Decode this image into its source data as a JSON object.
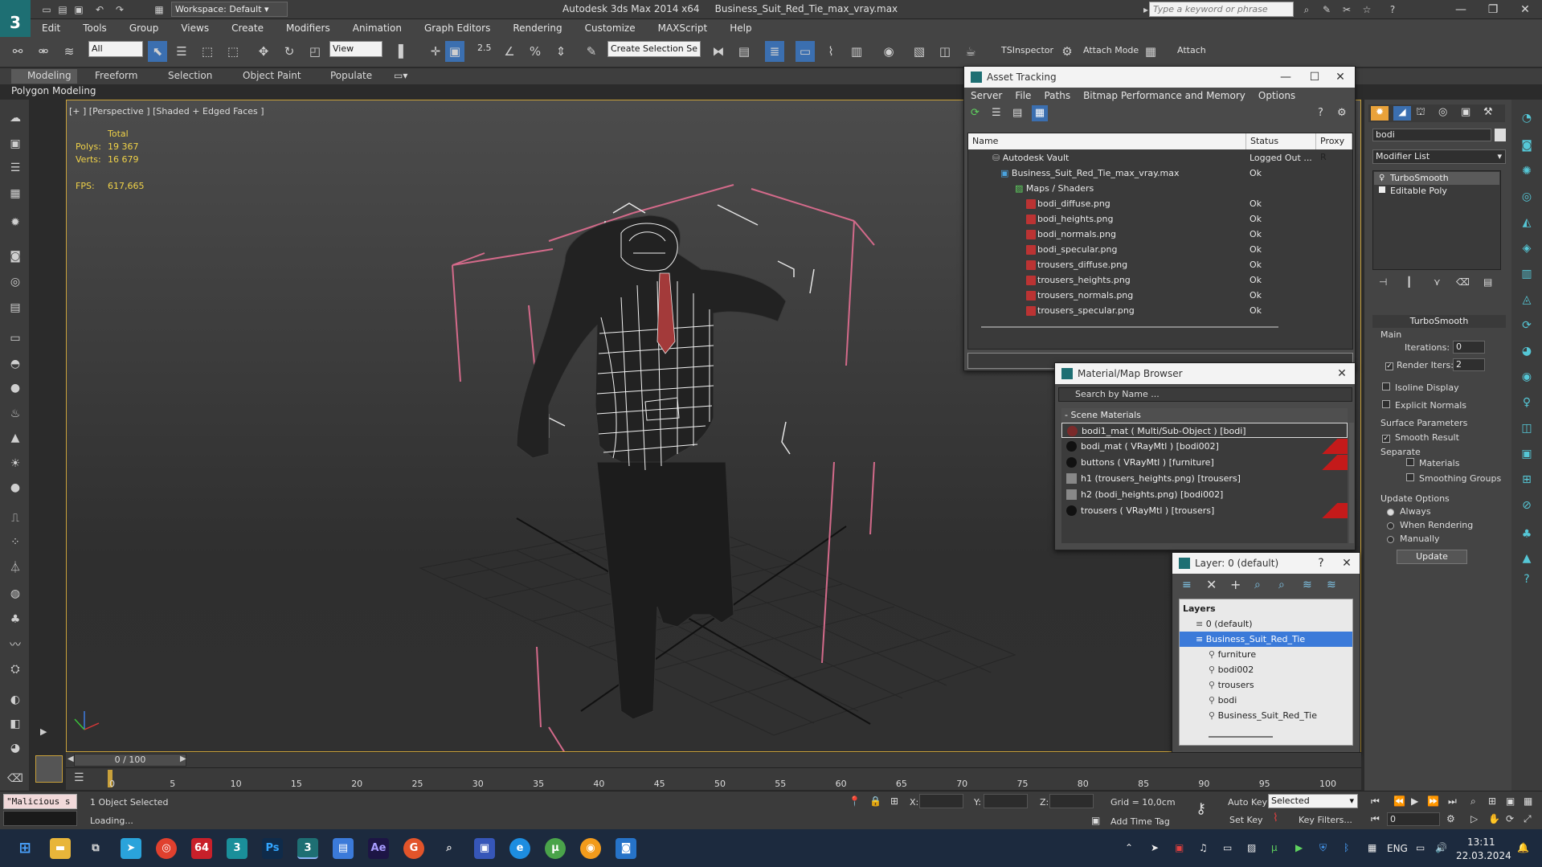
{
  "titlebar": {
    "workspace": "Workspace: Default",
    "app_name": "Autodesk 3ds Max  2014 x64",
    "file_name": "Business_Suit_Red_Tie_max_vray.max",
    "search_placeholder": "Type a keyword or phrase",
    "minimize": "—",
    "restore": "❐",
    "close": "✕"
  },
  "menu": [
    "Edit",
    "Tools",
    "Group",
    "Views",
    "Create",
    "Modifiers",
    "Animation",
    "Graph Editors",
    "Rendering",
    "Customize",
    "MAXScript",
    "Help"
  ],
  "toolbar": {
    "filter_value": "All",
    "reference_coord": "View",
    "selection_set": "Create Selection Se",
    "snap_label": "2.5",
    "ts_inspector": "TSInspector",
    "attach_mode": "Attach Mode",
    "attach": "Attach"
  },
  "ribbon": {
    "tabs": [
      "Modeling",
      "Freeform",
      "Selection",
      "Object Paint",
      "Populate"
    ],
    "active_tab": "Modeling",
    "sub_label": "Polygon Modeling"
  },
  "viewport": {
    "label": "[+ ] [Perspective ] [Shaded + Edged Faces ]",
    "stats_total": "Total",
    "polys_label": "Polys:",
    "polys_value": "19 367",
    "verts_label": "Verts:",
    "verts_value": "16 679",
    "fps_label": "FPS:",
    "fps_value": "617,665"
  },
  "asset_tracking": {
    "title": "Asset Tracking",
    "menu": [
      "Server",
      "File",
      "Paths",
      "Bitmap Performance and Memory",
      "Options"
    ],
    "columns": [
      "Name",
      "Status",
      "Proxy R"
    ],
    "rows": [
      {
        "name": "Autodesk Vault",
        "status": "Logged Out ..."
      },
      {
        "name": "Business_Suit_Red_Tie_max_vray.max",
        "status": "Ok"
      },
      {
        "name": "Maps / Shaders",
        "status": ""
      },
      {
        "name": "bodi_diffuse.png",
        "status": "Ok"
      },
      {
        "name": "bodi_heights.png",
        "status": "Ok"
      },
      {
        "name": "bodi_normals.png",
        "status": "Ok"
      },
      {
        "name": "bodi_specular.png",
        "status": "Ok"
      },
      {
        "name": "trousers_diffuse.png",
        "status": "Ok"
      },
      {
        "name": "trousers_heights.png",
        "status": "Ok"
      },
      {
        "name": "trousers_normals.png",
        "status": "Ok"
      },
      {
        "name": "trousers_specular.png",
        "status": "Ok"
      }
    ]
  },
  "material_browser": {
    "title": "Material/Map Browser",
    "search_placeholder": "Search by Name ...",
    "section": "- Scene Materials",
    "items": [
      "bodi1_mat  ( Multi/Sub-Object ) [bodi]",
      "bodi_mat  ( VRayMtl ) [bodi002]",
      "buttons  ( VRayMtl ) [furniture]",
      "h1 (trousers_heights.png) [trousers]",
      "h2 (bodi_heights.png) [bodi002]",
      "trousers  ( VRayMtl ) [trousers]"
    ]
  },
  "layer_dialog": {
    "title": "Layer: 0 (default)",
    "help": "?",
    "header": "Layers",
    "layers": [
      "0 (default)",
      "Business_Suit_Red_Tie",
      "furniture",
      "bodi002",
      "trousers",
      "bodi",
      "Business_Suit_Red_Tie"
    ],
    "selected_layer": "Business_Suit_Red_Tie"
  },
  "command_panel": {
    "search_value": "bodi",
    "modifier_list": "Modifier List",
    "stack": [
      "TurboSmooth",
      "Editable Poly"
    ],
    "rollout_title": "TurboSmooth",
    "main_group": "Main",
    "iterations_label": "Iterations:",
    "iterations_value": "0",
    "render_iters_label": "Render Iters:",
    "render_iters_value": "2",
    "isoline": "Isoline Display",
    "explicit_normals": "Explicit Normals",
    "surface_params": "Surface Parameters",
    "smooth_result": "Smooth Result",
    "separate": "Separate",
    "materials": "Materials",
    "smoothing_groups": "Smoothing Groups",
    "update_options": "Update Options",
    "always": "Always",
    "when_rendering": "When Rendering",
    "manually": "Manually",
    "update_button": "Update"
  },
  "timeline": {
    "slider": "0 / 100",
    "ticks": [
      "0",
      "5",
      "10",
      "15",
      "20",
      "25",
      "30",
      "35",
      "40",
      "45",
      "50",
      "55",
      "60",
      "65",
      "70",
      "75",
      "80",
      "85",
      "90",
      "95",
      "100"
    ]
  },
  "status": {
    "script_text": "\"Malicious s",
    "selected": "1 Object Selected",
    "loading": "Loading...",
    "x_label": "X:",
    "y_label": "Y:",
    "z_label": "Z:",
    "grid": "Grid = 10,0cm",
    "add_time_tag": "Add Time Tag",
    "auto_key": "Auto Key",
    "set_key": "Set Key",
    "selected_dropdown": "Selected",
    "key_filters": "Key Filters...",
    "frame_value": "0"
  },
  "taskbar": {
    "app_64": "64",
    "lang": "ENG",
    "time": "13:11",
    "date": "22.03.2024"
  },
  "colors": {
    "accent": "#1e6f73",
    "selection_blue": "#3b7ad9",
    "stats_yellow": "#f0d248",
    "red_flag": "#c41a1a"
  }
}
